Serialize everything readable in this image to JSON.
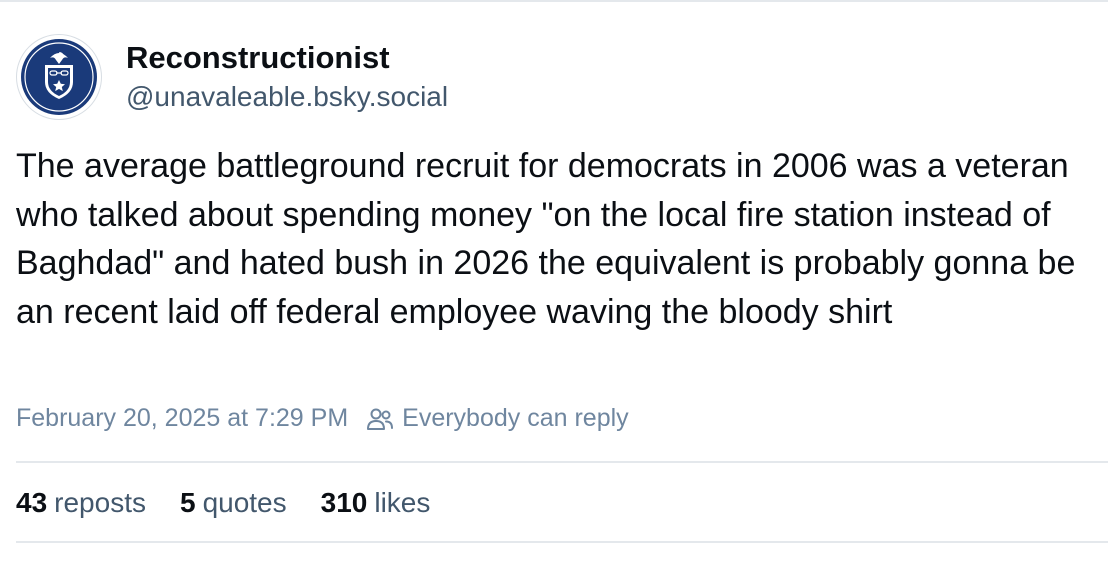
{
  "author": {
    "display_name": "Reconstructionist",
    "handle": "@unavaleable.bsky.social",
    "avatar_icon": "eagle-shield-emblem-icon"
  },
  "post": {
    "text": "The average battleground recruit for democrats in 2006 was a veteran who talked about spending money \"on the local fire station instead of Baghdad\" and hated bush in 2026 the equivalent is probably gonna be an recent laid off federal employee waving the bloody shirt",
    "timestamp": "February 20, 2025 at 7:29 PM",
    "reply_setting": "Everybody can reply",
    "reply_setting_icon": "people-icon"
  },
  "stats": {
    "reposts_count": "43",
    "reposts_label": "reposts",
    "quotes_count": "5",
    "quotes_label": "quotes",
    "likes_count": "310",
    "likes_label": "likes"
  },
  "colors": {
    "primary_text": "#0b0f14",
    "secondary_text": "#42576c",
    "meta_text": "#6f869f",
    "divider": "#e4e8ec",
    "avatar_navy": "#1a3a7a"
  }
}
